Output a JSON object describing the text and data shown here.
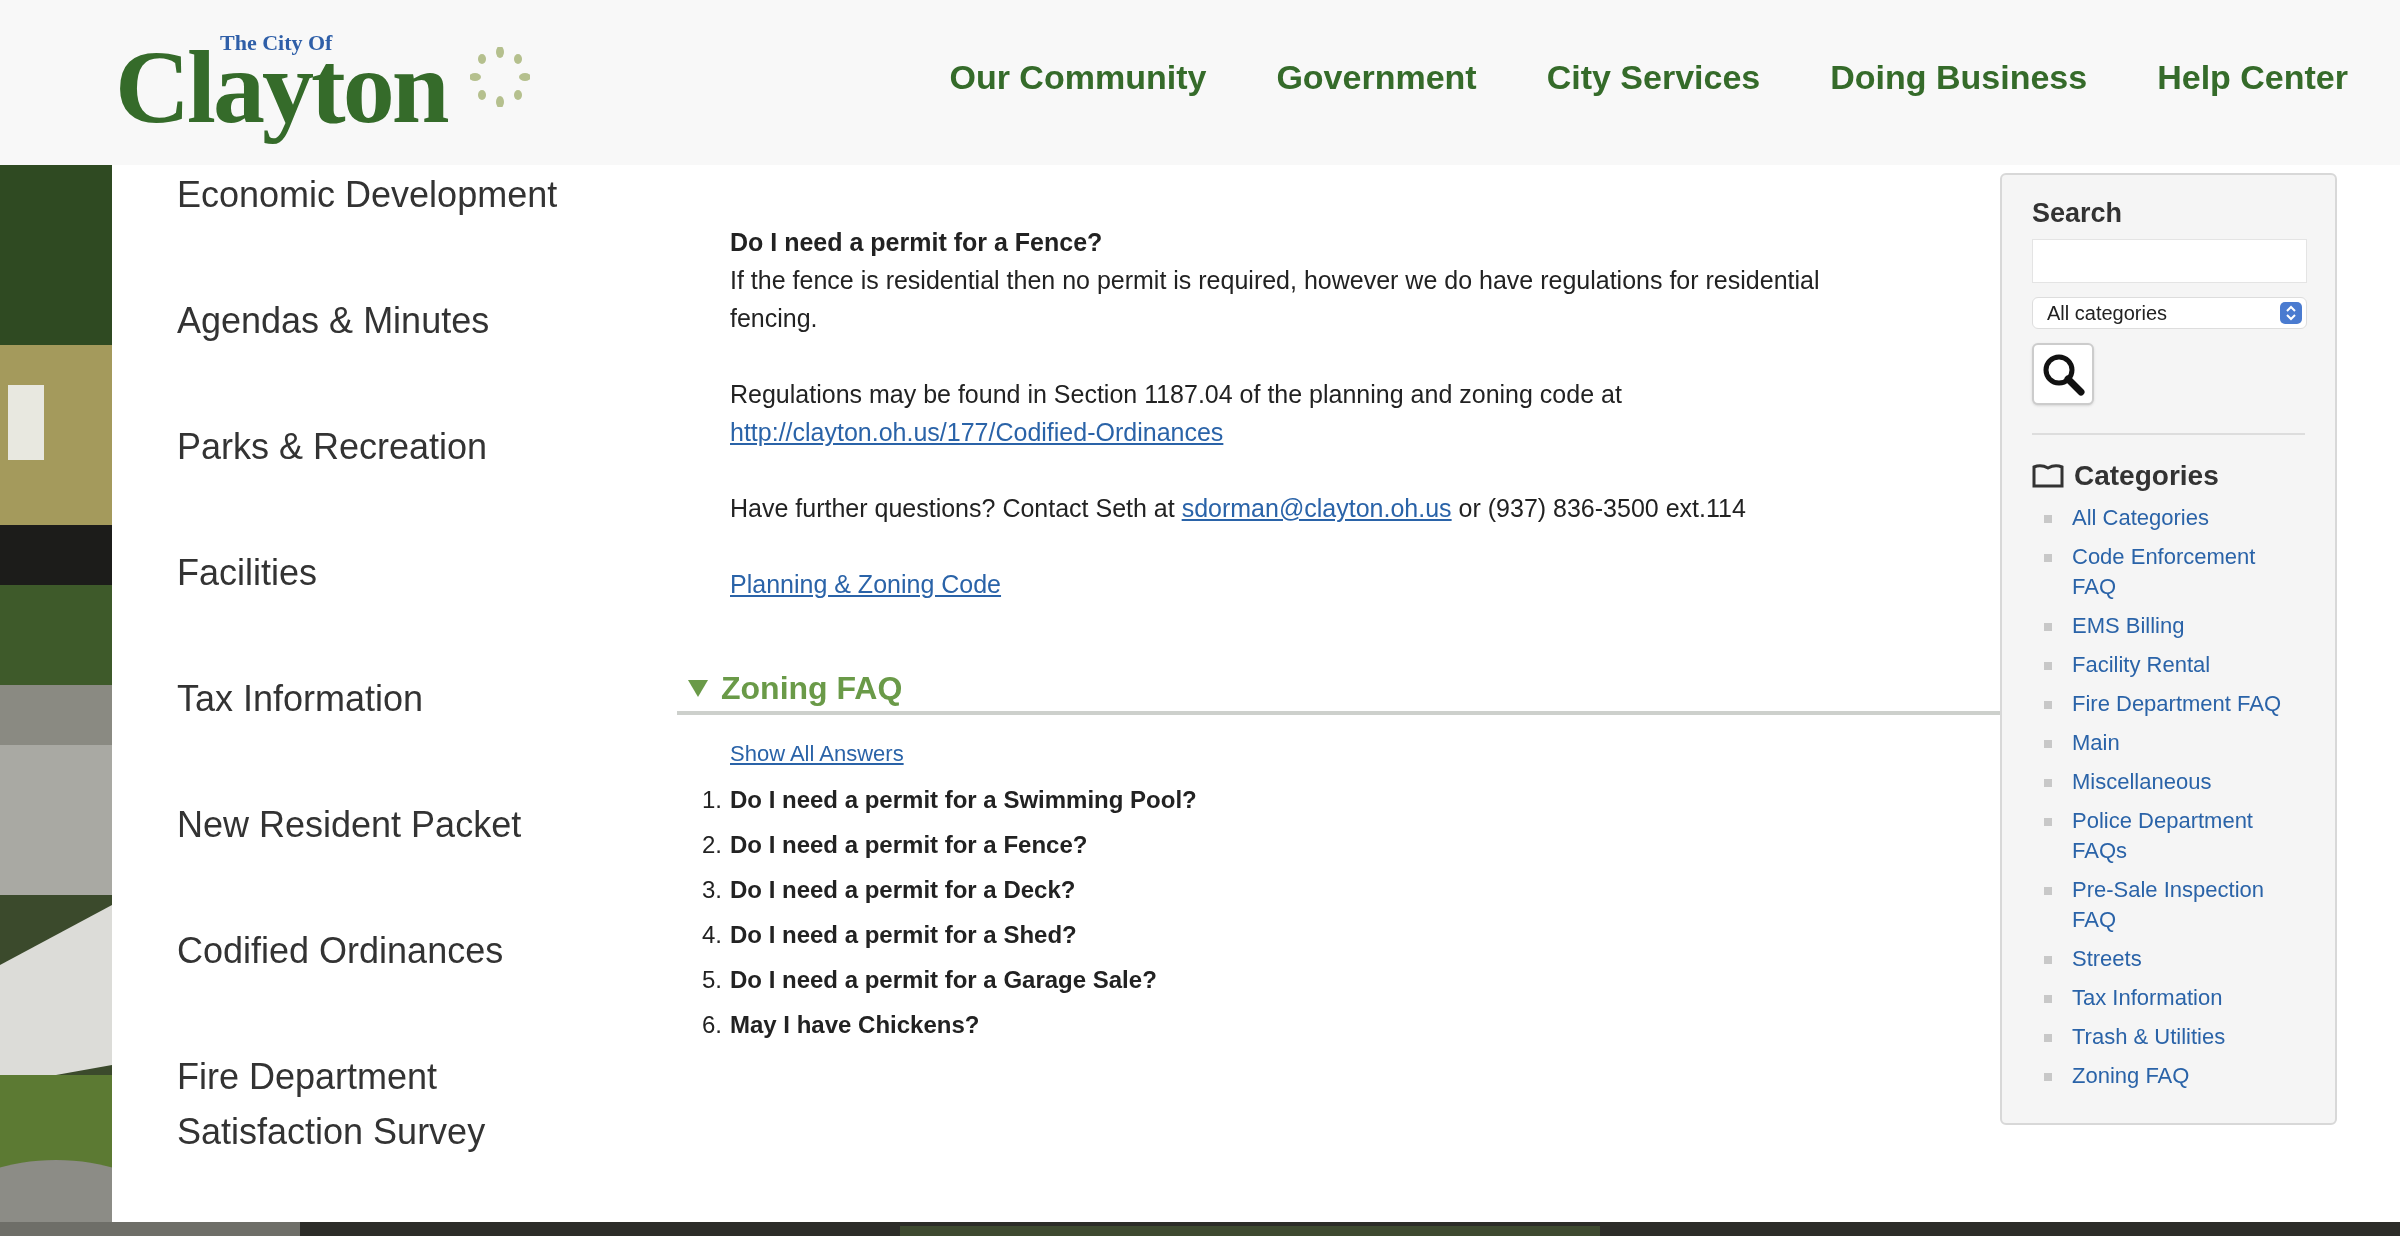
{
  "header": {
    "logo": {
      "tagline": "The City Of",
      "name": "Clayton"
    },
    "nav": [
      "Our Community",
      "Government",
      "City Services",
      "Doing Business",
      "Help Center"
    ]
  },
  "left_nav": [
    "Economic Development",
    "Agendas & Minutes",
    "Parks & Recreation",
    "Facilities",
    "Tax Information",
    "New Resident Packet",
    "Codified Ordinances",
    "Fire Department Satisfaction Survey"
  ],
  "answer": {
    "question": "Do I need a permit for a Fence?",
    "paragraphs": [
      [
        {
          "kind": "text",
          "text": "If the fence is residential then no permit is required, however we do have regulations for residential fencing."
        }
      ],
      [
        {
          "kind": "text",
          "text": "Regulations may be found in Section 1187.04 of the planning and zoning code at "
        },
        {
          "kind": "link",
          "text": "http://clayton.oh.us/177/Codified-Ordinances"
        }
      ],
      [
        {
          "kind": "text",
          "text": "Have further questions? Contact Seth at "
        },
        {
          "kind": "link",
          "text": "sdorman@clayton.oh.us"
        },
        {
          "kind": "text",
          "text": " or (937) 836-3500 ext.114"
        }
      ],
      [
        {
          "kind": "link",
          "text": "Planning & Zoning Code"
        }
      ]
    ]
  },
  "section": {
    "title": "Zoning FAQ",
    "expanded": true,
    "show_all": "Show All Answers",
    "questions": [
      {
        "number": "1.",
        "text": "Do I need a permit for a Swimming Pool?"
      },
      {
        "number": "2.",
        "text": "Do I need a permit for a Fence?"
      },
      {
        "number": "3.",
        "text": "Do I need a permit for a Deck?"
      },
      {
        "number": "4.",
        "text": "Do I need a permit for a Shed?"
      },
      {
        "number": "5.",
        "text": "Do I need a permit for a Garage Sale?"
      },
      {
        "number": "6.",
        "text": "May I have Chickens?"
      }
    ]
  },
  "sidebar": {
    "search_title": "Search",
    "select": "All categories",
    "categories_title": "Categories",
    "categories": [
      "All Categories",
      "Code Enforcement FAQ",
      "EMS Billing",
      "Facility Rental",
      "Fire Department FAQ",
      "Main",
      "Miscellaneous",
      "Police Department FAQs",
      "Pre-Sale Inspection FAQ",
      "Streets",
      "Tax Information",
      "Trash & Utilities",
      "Zoning FAQ"
    ]
  }
}
